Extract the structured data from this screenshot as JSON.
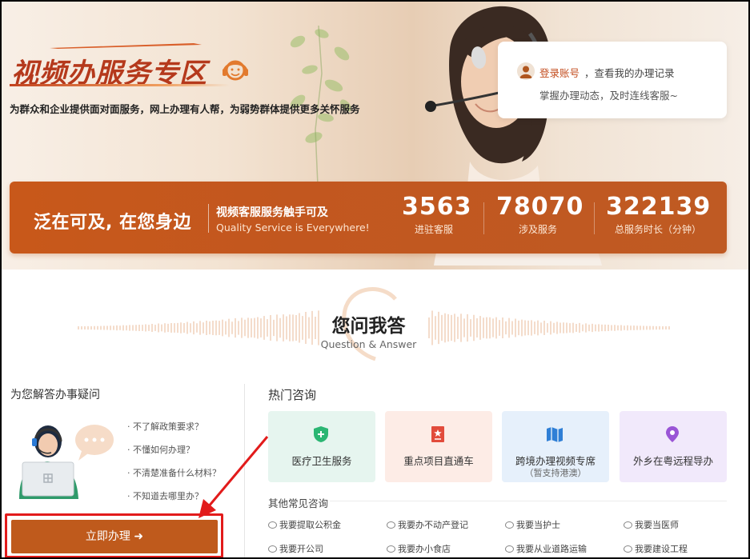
{
  "hero": {
    "title": "视频办服务专区",
    "subtitle": "为群众和企业提供面对面服务，网上办理有人帮，为弱势群体提供更多关怀服务"
  },
  "login_card": {
    "link": "登录账号",
    "link_rest": "，查看我的办理记录",
    "desc": "掌握办理动态，及时连线客服~"
  },
  "banner": {
    "slogan": "泛在可及, 在您身边",
    "tag": "视频客服服务触手可及",
    "tag_en": "Quality Service is Everywhere!",
    "stats": [
      {
        "value": "3563",
        "label": "进驻客服"
      },
      {
        "value": "78070",
        "label": "涉及服务"
      },
      {
        "value": "322139",
        "label": "总服务时长（分钟）"
      }
    ]
  },
  "qa": {
    "title": "您问我答",
    "subtitle": "Question & Answer"
  },
  "left": {
    "title": "为您解答办事疑问",
    "questions": [
      "· 不了解政策要求？",
      "· 不懂如何办理？",
      "· 不清楚准备什么材料？",
      "· 不知道去哪里办？"
    ],
    "action": "立即办理 ➜"
  },
  "hot": {
    "title": "热门咨询",
    "cards": [
      {
        "label": "医疗卫生服务",
        "sub": "",
        "icon": "shield-plus-icon",
        "bg": "#e6f5ef",
        "color": "#2bb673"
      },
      {
        "label": "重点项目直通车",
        "sub": "",
        "icon": "document-star-icon",
        "bg": "#fdece6",
        "color": "#e24b3b"
      },
      {
        "label": "跨境办理视频专席",
        "sub": "（暂支持港澳）",
        "icon": "map-icon",
        "bg": "#e6f0fb",
        "color": "#2f7fd6"
      },
      {
        "label": "外乡在粤远程导办",
        "sub": "",
        "icon": "location-pin-icon",
        "bg": "#f1e9fb",
        "color": "#9a55d6"
      }
    ]
  },
  "other": {
    "title": "其他常见咨询",
    "items": [
      "我要提取公积金",
      "我要办不动产登记",
      "我要当护士",
      "我要当医师",
      "我要开公司",
      "我要办小食店",
      "我要从业道路运输",
      "我要建设工程"
    ]
  }
}
